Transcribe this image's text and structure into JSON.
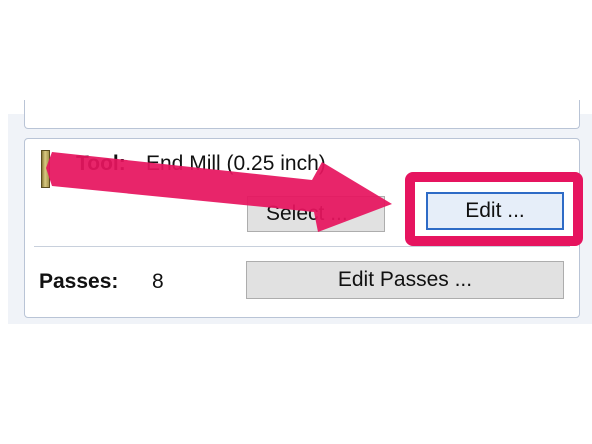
{
  "tool_section": {
    "label": "Tool:",
    "tool_name": "End Mill (0.25 inch)",
    "select_button": "Select ...",
    "edit_button": "Edit ...",
    "icon": "end-mill-tool-icon"
  },
  "passes_section": {
    "label": "Passes:",
    "value": "8",
    "edit_passes_button": "Edit Passes ..."
  },
  "annotation": {
    "highlight_color": "#e6145f",
    "arrow_color": "#e6145f",
    "icon": "arrow-right-icon"
  }
}
